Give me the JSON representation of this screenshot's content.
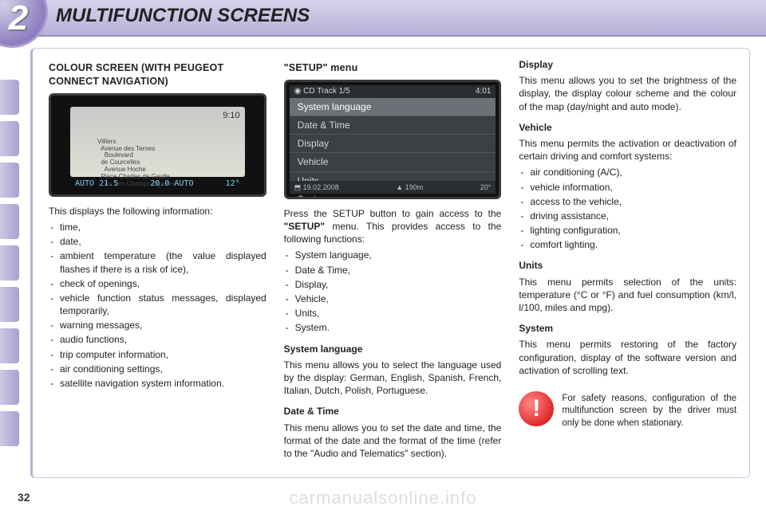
{
  "header": {
    "chapter_number": "2",
    "chapter_title": "MULTIFUNCTION SCREENS"
  },
  "col1": {
    "title": "COLOUR SCREEN (WITH PEUGEOT CONNECT NAVIGATION)",
    "nav_shot": {
      "clock": "9:10",
      "status_left": "AUTO 21.5",
      "status_mid": "20.0 AUTO",
      "status_right": "12°",
      "map_labels": "Villiers\n  Avenue des Ternes\n    Boulevard\n  de Courcelles\n    Avenue Hoche\n  Place Charles de Gaulle\n    Av. des Champs-Elysées"
    },
    "intro": "This displays the following information:",
    "items": [
      "time,",
      "date,",
      "ambient temperature (the value displayed flashes if there is a risk of ice),",
      "check of openings,",
      "vehicle function status messages, displayed temporarily,",
      "warning messages,",
      "audio functions,",
      "trip computer information,",
      "air conditioning settings,",
      "satellite navigation system information."
    ]
  },
  "col2": {
    "title": "\"SETUP\" menu",
    "setup_shot": {
      "top_left": "◉ CD      Track 1/5",
      "top_right": "4:01",
      "menu": [
        "System language",
        "Date & Time",
        "Display",
        "Vehicle",
        "Units",
        "System"
      ],
      "selected_index": 0,
      "bot_left": "⬒  19.02.2008",
      "bot_mid": "▲ 190m",
      "bot_right": "20°"
    },
    "intro_pre": "Press the SETUP button to gain access to the ",
    "intro_bold": "\"SETUP\"",
    "intro_post": " menu. This provides access to the following functions:",
    "items": [
      "System language,",
      "Date & Time,",
      "Display,",
      "Vehicle,",
      "Units,",
      "System."
    ],
    "syslang_title": "System language",
    "syslang_body": "This menu allows you to select the language used by the display: German, English, Spanish, French, Italian, Dutch, Polish, Portuguese.",
    "datetime_title": "Date & Time",
    "datetime_body": "This menu allows you to set the date and time, the format of the date and the format of the time (refer to the \"Audio and Telematics\" section)."
  },
  "col3": {
    "display_title": "Display",
    "display_body": "This menu allows you to set the brightness of the display, the display colour scheme and the colour of the map (day/night and auto mode).",
    "vehicle_title": "Vehicle",
    "vehicle_body": "This menu permits the activation or deactivation of certain driving and comfort systems:",
    "vehicle_items": [
      "air conditioning (A/C),",
      "vehicle information,",
      "access to the vehicle,",
      "driving assistance,",
      "lighting configuration,",
      "comfort lighting."
    ],
    "units_title": "Units",
    "units_body": "This menu permits selection of the units: temperature (°C or °F) and fuel consumption (km/l, l/100, miles and mpg).",
    "system_title": "System",
    "system_body": "This menu permits restoring of the factory configuration, display of the software version and activation of scrolling text.",
    "warning": "For safety reasons, configuration of the multifunction screen by the driver must only be done when stationary."
  },
  "page_number": "32",
  "watermark": "carmanualsonline.info"
}
